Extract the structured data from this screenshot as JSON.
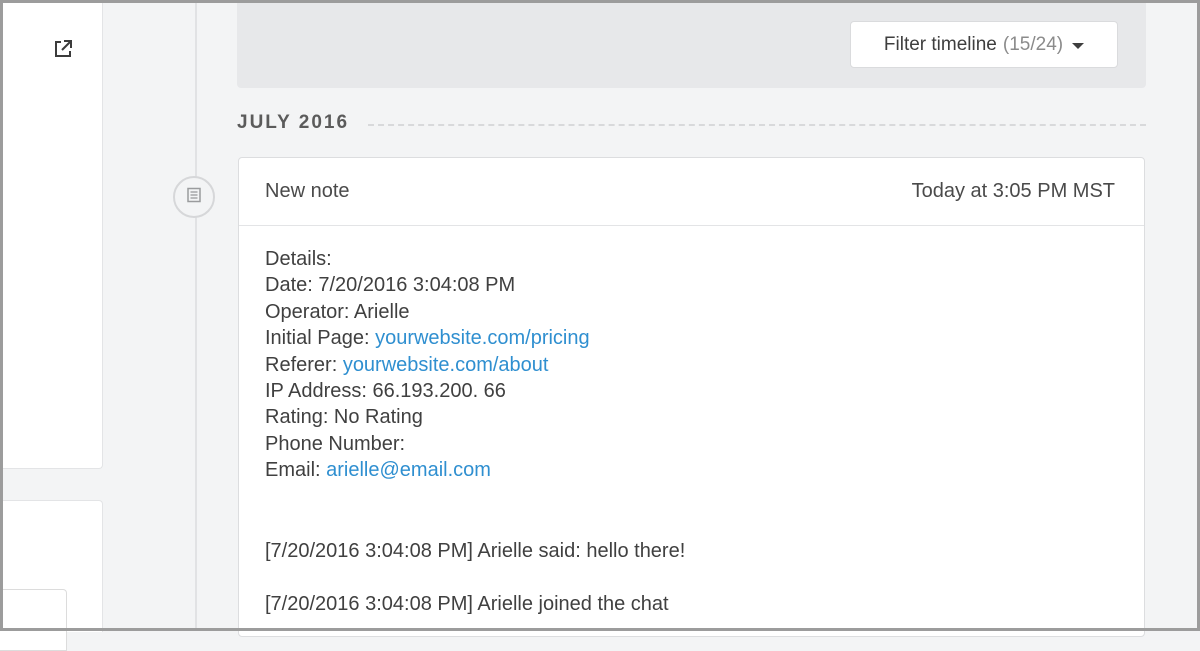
{
  "filter": {
    "label": "Filter timeline",
    "count": "(15/24)"
  },
  "timeline": {
    "month": "JULY 2016"
  },
  "note": {
    "title": "New note",
    "timestamp": "Today at 3:05 PM MST",
    "details_label": "Details:",
    "date_label": "Date: 7/20/2016 3:04:08 PM",
    "operator_label": "Operator: Arielle",
    "initial_page_label": "Initial Page:",
    "initial_page_link": "yourwebsite.com/pricing",
    "referer_label": "Referer:",
    "referer_link": "yourwebsite.com/about",
    "ip_label": "IP Address: 66.193.200. 66",
    "rating_label": "Rating: No Rating",
    "phone_label": "Phone Number:",
    "email_label": "Email:",
    "email_link": "arielle@email.com",
    "chat": [
      "[7/20/2016 3:04:08 PM] Arielle said: hello there!",
      "[7/20/2016 3:04:08 PM] Arielle joined the chat"
    ]
  },
  "icons": {
    "external_link": "external-link-icon",
    "note": "note-icon",
    "caret": "caret-down-icon"
  },
  "colors": {
    "link": "#2f8fd0",
    "background": "#f3f4f5"
  }
}
